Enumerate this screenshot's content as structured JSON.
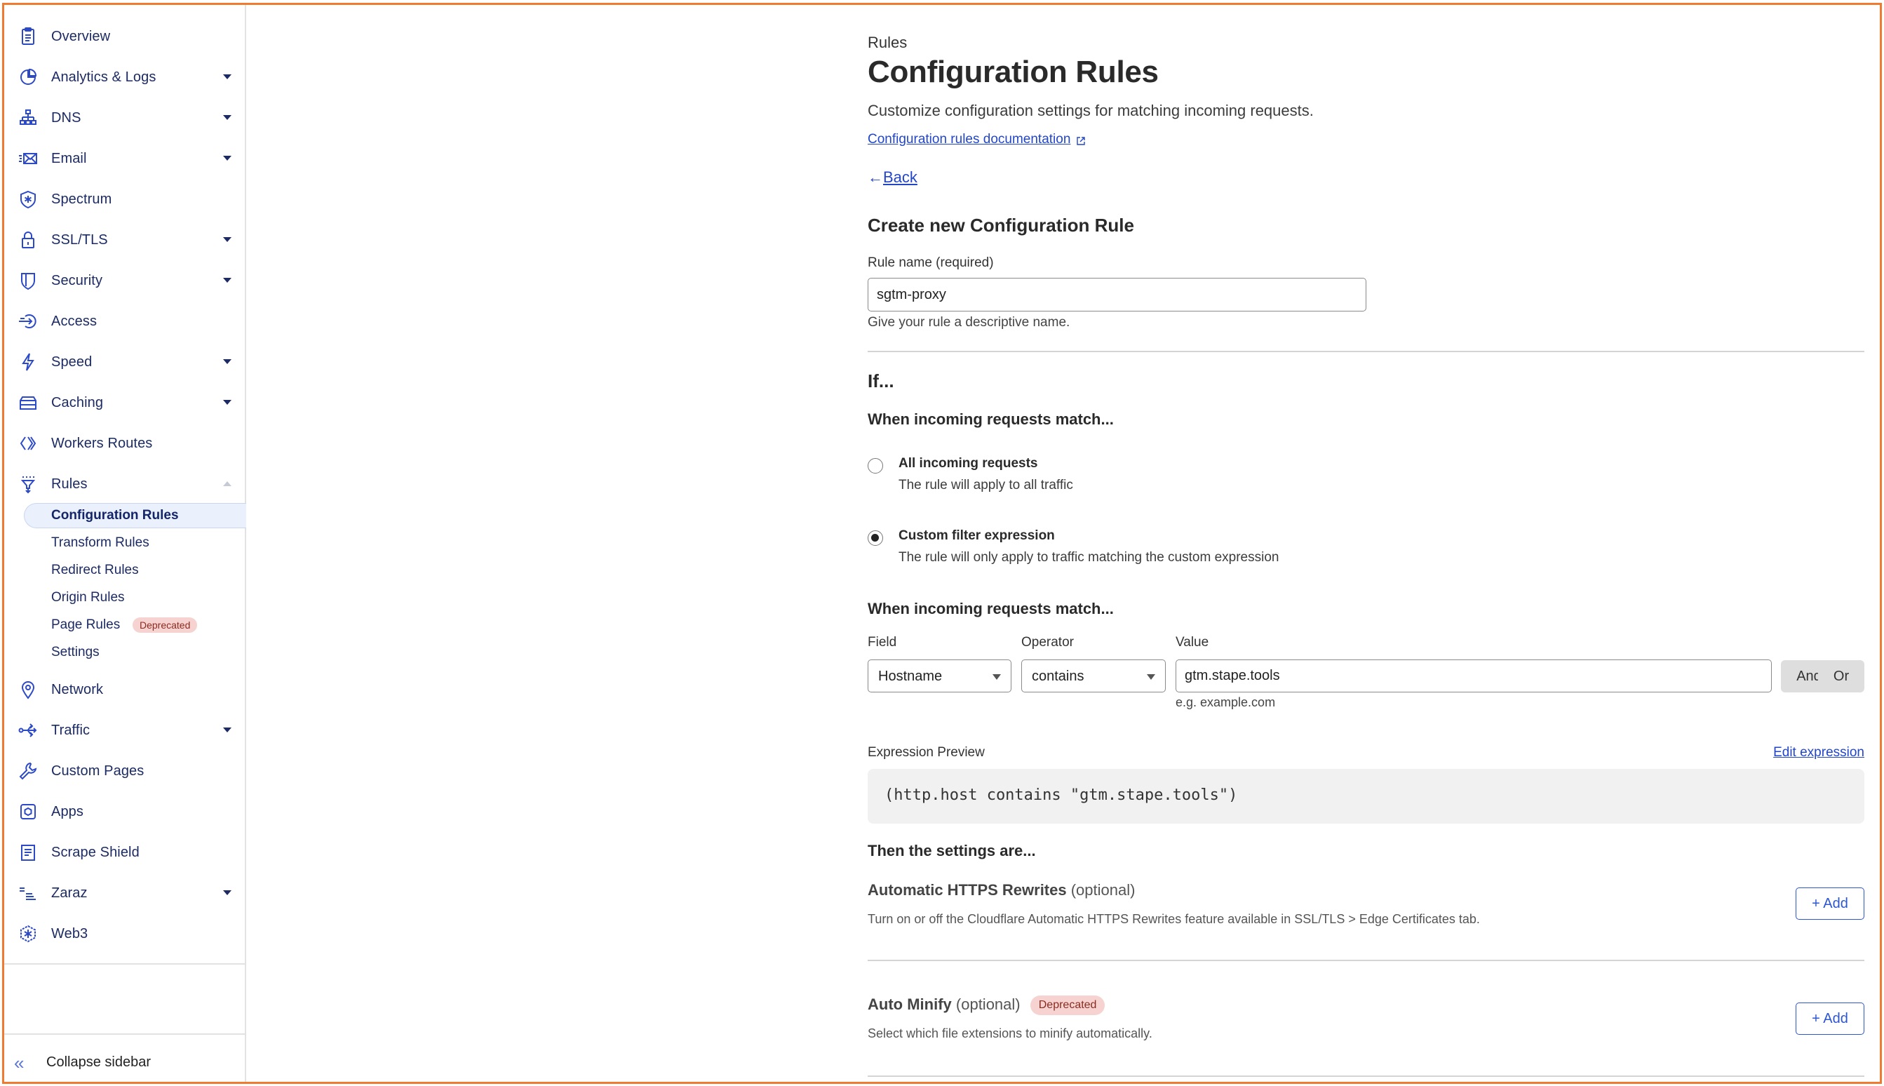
{
  "sidebar": {
    "items": [
      {
        "label": "Overview",
        "icon": "clipboard-icon",
        "has_caret": false
      },
      {
        "label": "Analytics & Logs",
        "icon": "pie-chart-icon",
        "has_caret": true
      },
      {
        "label": "DNS",
        "icon": "network-tree-icon",
        "has_caret": true
      },
      {
        "label": "Email",
        "icon": "envelope-icon",
        "has_caret": true
      },
      {
        "label": "Spectrum",
        "icon": "shield-snowflake-icon",
        "has_caret": false
      },
      {
        "label": "SSL/TLS",
        "icon": "lock-icon",
        "has_caret": true
      },
      {
        "label": "Security",
        "icon": "shield-icon",
        "has_caret": true
      },
      {
        "label": "Access",
        "icon": "sign-in-icon",
        "has_caret": false
      },
      {
        "label": "Speed",
        "icon": "lightning-icon",
        "has_caret": true
      },
      {
        "label": "Caching",
        "icon": "server-stack-icon",
        "has_caret": true
      },
      {
        "label": "Workers Routes",
        "icon": "workers-icon",
        "has_caret": false
      },
      {
        "label": "Rules",
        "icon": "funnel-icon",
        "has_caret": true,
        "expanded": true
      }
    ],
    "rules_sub_items": [
      {
        "label": "Configuration Rules",
        "active": true
      },
      {
        "label": "Transform Rules"
      },
      {
        "label": "Redirect Rules"
      },
      {
        "label": "Origin Rules"
      },
      {
        "label": "Page Rules",
        "badge": "Deprecated"
      },
      {
        "label": "Settings"
      }
    ],
    "items_after": [
      {
        "label": "Network",
        "icon": "location-pin-icon",
        "has_caret": false
      },
      {
        "label": "Traffic",
        "icon": "traffic-split-icon",
        "has_caret": true
      },
      {
        "label": "Custom Pages",
        "icon": "wrench-icon",
        "has_caret": false
      },
      {
        "label": "Apps",
        "icon": "apps-icon",
        "has_caret": false
      },
      {
        "label": "Scrape Shield",
        "icon": "document-icon",
        "has_caret": false
      },
      {
        "label": "Zaraz",
        "icon": "zaraz-icon",
        "has_caret": true
      },
      {
        "label": "Web3",
        "icon": "web3-icon",
        "has_caret": false
      }
    ],
    "collapse_label": "Collapse sidebar"
  },
  "header": {
    "breadcrumb": "Rules",
    "title": "Configuration Rules",
    "subtitle": "Customize configuration settings for matching incoming requests.",
    "doc_link": "Configuration rules documentation",
    "back_label": "Back"
  },
  "form": {
    "section_title": "Create new Configuration Rule",
    "rule_name_label": "Rule name (required)",
    "rule_name_value": "sgtm-proxy",
    "rule_name_help": "Give your rule a descriptive name.",
    "if_title": "If...",
    "match_heading": "When incoming requests match...",
    "radio_options": [
      {
        "title": "All incoming requests",
        "desc": "The rule will apply to all traffic",
        "checked": false
      },
      {
        "title": "Custom filter expression",
        "desc": "The rule will only apply to traffic matching the custom expression",
        "checked": true
      }
    ],
    "match_heading_2": "When incoming requests match...",
    "field_label": "Field",
    "field_value": "Hostname",
    "operator_label": "Operator",
    "operator_value": "contains",
    "value_label": "Value",
    "value_value": "gtm.stape.tools",
    "value_hint": "e.g. example.com",
    "and_label": "And",
    "or_label": "Or",
    "expression_preview_label": "Expression Preview",
    "edit_expression_label": "Edit expression",
    "expression": "(http.host contains \"gtm.stape.tools\")",
    "then_heading": "Then the settings are...",
    "settings": [
      {
        "name": "Automatic HTTPS Rewrites",
        "optional": "(optional)",
        "desc": "Turn on or off the Cloudflare Automatic HTTPS Rewrites feature available in SSL/TLS > Edge Certificates tab.",
        "button": "+ Add"
      },
      {
        "name": "Auto Minify",
        "optional": "(optional)",
        "badge": "Deprecated",
        "desc": "Select which file extensions to minify automatically.",
        "button": "+ Add"
      }
    ]
  },
  "colors": {
    "accent_link": "#2346c9",
    "sidebar_text": "#1c2b63",
    "active_bg": "#eaf1fd",
    "deprecated_bg": "#f6d3d0",
    "frame_border": "#ee7b30"
  }
}
